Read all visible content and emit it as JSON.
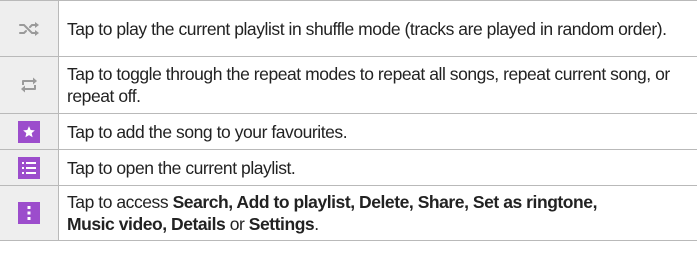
{
  "rows": [
    {
      "icon": "shuffle-icon",
      "text": "Tap to play the current playlist in shuffle mode (tracks are played in random order)."
    },
    {
      "icon": "repeat-icon",
      "text": "Tap to toggle through the repeat modes to repeat all songs, repeat current song, or repeat off."
    },
    {
      "icon": "star-icon",
      "text": "Tap to add the song to your favourites."
    },
    {
      "icon": "playlist-icon",
      "text": "Tap to open the current playlist."
    },
    {
      "icon": "more-options-icon",
      "prefix": "Tap to access ",
      "options": [
        "Search, Add to playlist, Delete, Share, Set as ringtone,",
        "Music video, Details",
        "Settings"
      ],
      "or": " or ",
      "suffix": "."
    }
  ],
  "colors": {
    "accent": "#9c4dcc",
    "icon_gray": "#9a9a9a",
    "cell_bg": "#eeeeee",
    "border": "#b9b9b9"
  }
}
